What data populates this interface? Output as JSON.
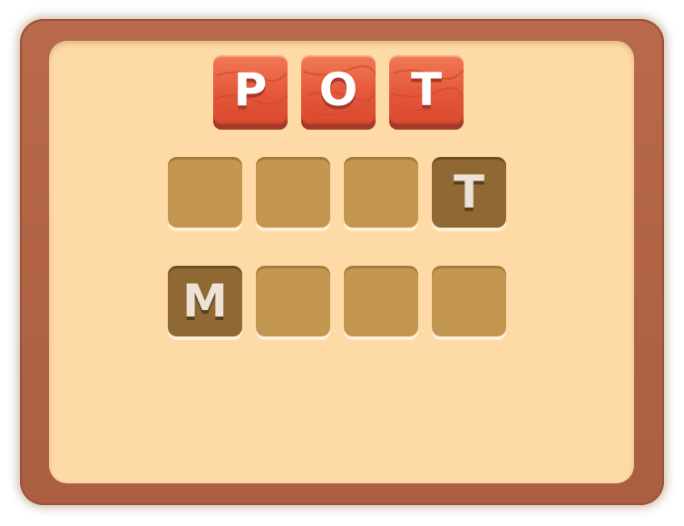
{
  "tray": {
    "tiles": [
      {
        "letter": "P"
      },
      {
        "letter": "O"
      },
      {
        "letter": "T"
      }
    ]
  },
  "grid": {
    "rows": [
      {
        "slots": [
          "",
          "",
          "",
          "T"
        ]
      },
      {
        "slots": [
          "M",
          "",
          "",
          ""
        ]
      }
    ]
  },
  "colors": {
    "frame": "#b86a4a",
    "board": "#fedaa6",
    "tile": "#e4573a",
    "slot_empty": "#c39651",
    "slot_filled": "#906833"
  }
}
